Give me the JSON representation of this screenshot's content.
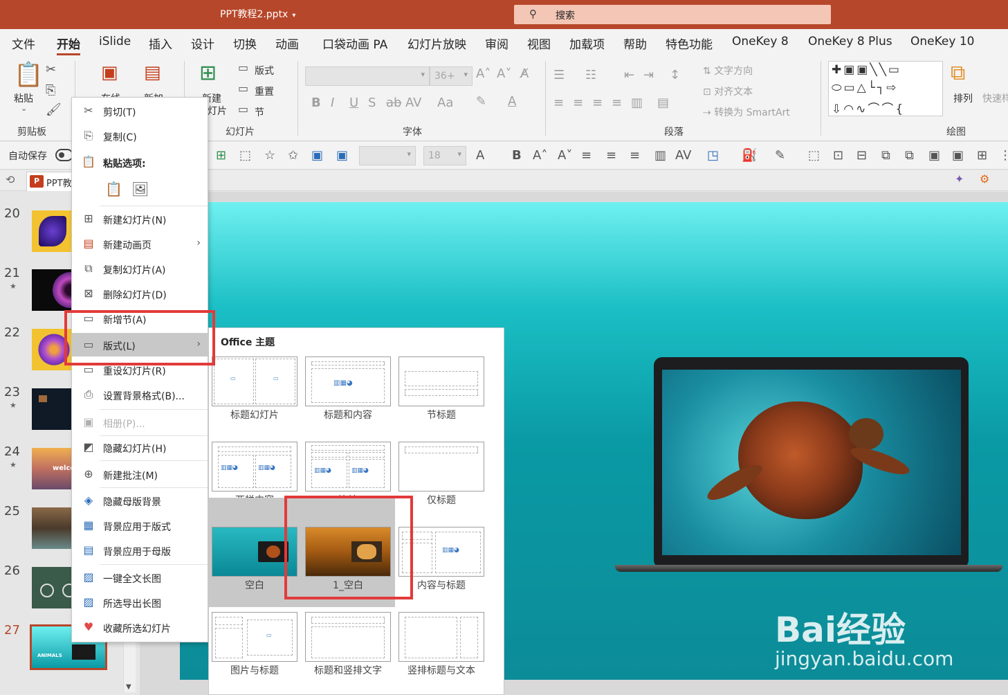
{
  "window": {
    "doc_title": "PPT教程2.pptx",
    "search_placeholder": "搜索"
  },
  "menu_tabs": [
    "文件",
    "开始",
    "iSlide",
    "插入",
    "设计",
    "切换",
    "动画",
    "口袋动画 PA",
    "幻灯片放映",
    "审阅",
    "视图",
    "加载项",
    "帮助",
    "特色功能",
    "OneKey 8",
    "OneKey 8 Plus",
    "OneKey 10"
  ],
  "active_tab": "开始",
  "ribbon": {
    "paste": "粘贴",
    "online": "在线",
    "new_add": "新加",
    "new_slide_1": "新建",
    "new_slide_2": "灯片",
    "layout": "版式",
    "reset": "重置",
    "section": "节",
    "font_size": "36+",
    "text_direction": "文字方向",
    "align_text": "对齐文本",
    "smartart": "转换为 SmartArt",
    "arrange": "排列",
    "quick_style": "快速样",
    "groups": {
      "clipboard": "剪贴板",
      "slides": "幻灯片",
      "font": "字体",
      "paragraph": "段落",
      "drawing": "绘图"
    }
  },
  "qat": {
    "autosave": "自动保存",
    "font_size": "18"
  },
  "doc_tab": "PPT教",
  "thumbnails": [
    {
      "num": "20",
      "star": false
    },
    {
      "num": "21",
      "star": true
    },
    {
      "num": "22",
      "star": false
    },
    {
      "num": "23",
      "star": true
    },
    {
      "num": "24",
      "star": true
    },
    {
      "num": "25",
      "star": false
    },
    {
      "num": "26",
      "star": false
    },
    {
      "num": "27",
      "star": false
    }
  ],
  "thumb_text": {
    "welcome": "welco",
    "animals": "ANIMALS"
  },
  "context_menu": {
    "cut": "剪切(T)",
    "copy": "复制(C)",
    "paste_options": "粘贴选项:",
    "new_slide": "新建幻灯片(N)",
    "new_anim_page": "新建动画页",
    "duplicate": "复制幻灯片(A)",
    "delete": "删除幻灯片(D)",
    "add_section": "新增节(A)",
    "layout": "版式(L)",
    "reset": "重设幻灯片(R)",
    "format_bg": "设置背景格式(B)...",
    "album": "相册(P)...",
    "hide": "隐藏幻灯片(H)",
    "new_comment": "新建批注(M)",
    "hide_master_bg": "隐藏母版背景",
    "apply_bg_layout": "背景应用于版式",
    "apply_bg_master": "背景应用于母版",
    "long_image": "一键全文长图",
    "export_long": "所选导出长图",
    "collect": "收藏所选幻灯片"
  },
  "layout_flyout": {
    "title": "Office 主题",
    "layouts": [
      "标题幻灯片",
      "标题和内容",
      "节标题",
      "两栏内容",
      "比较",
      "仅标题",
      "空白",
      "1_空白",
      "内容与标题",
      "图片与标题",
      "标题和竖排文字",
      "竖排标题与文本"
    ]
  },
  "watermark": {
    "brand": "Bai经验",
    "url": "jingyan.baidu.com"
  },
  "colors": {
    "accent": "#b7472a",
    "highlight_box": "#e23a3a"
  }
}
